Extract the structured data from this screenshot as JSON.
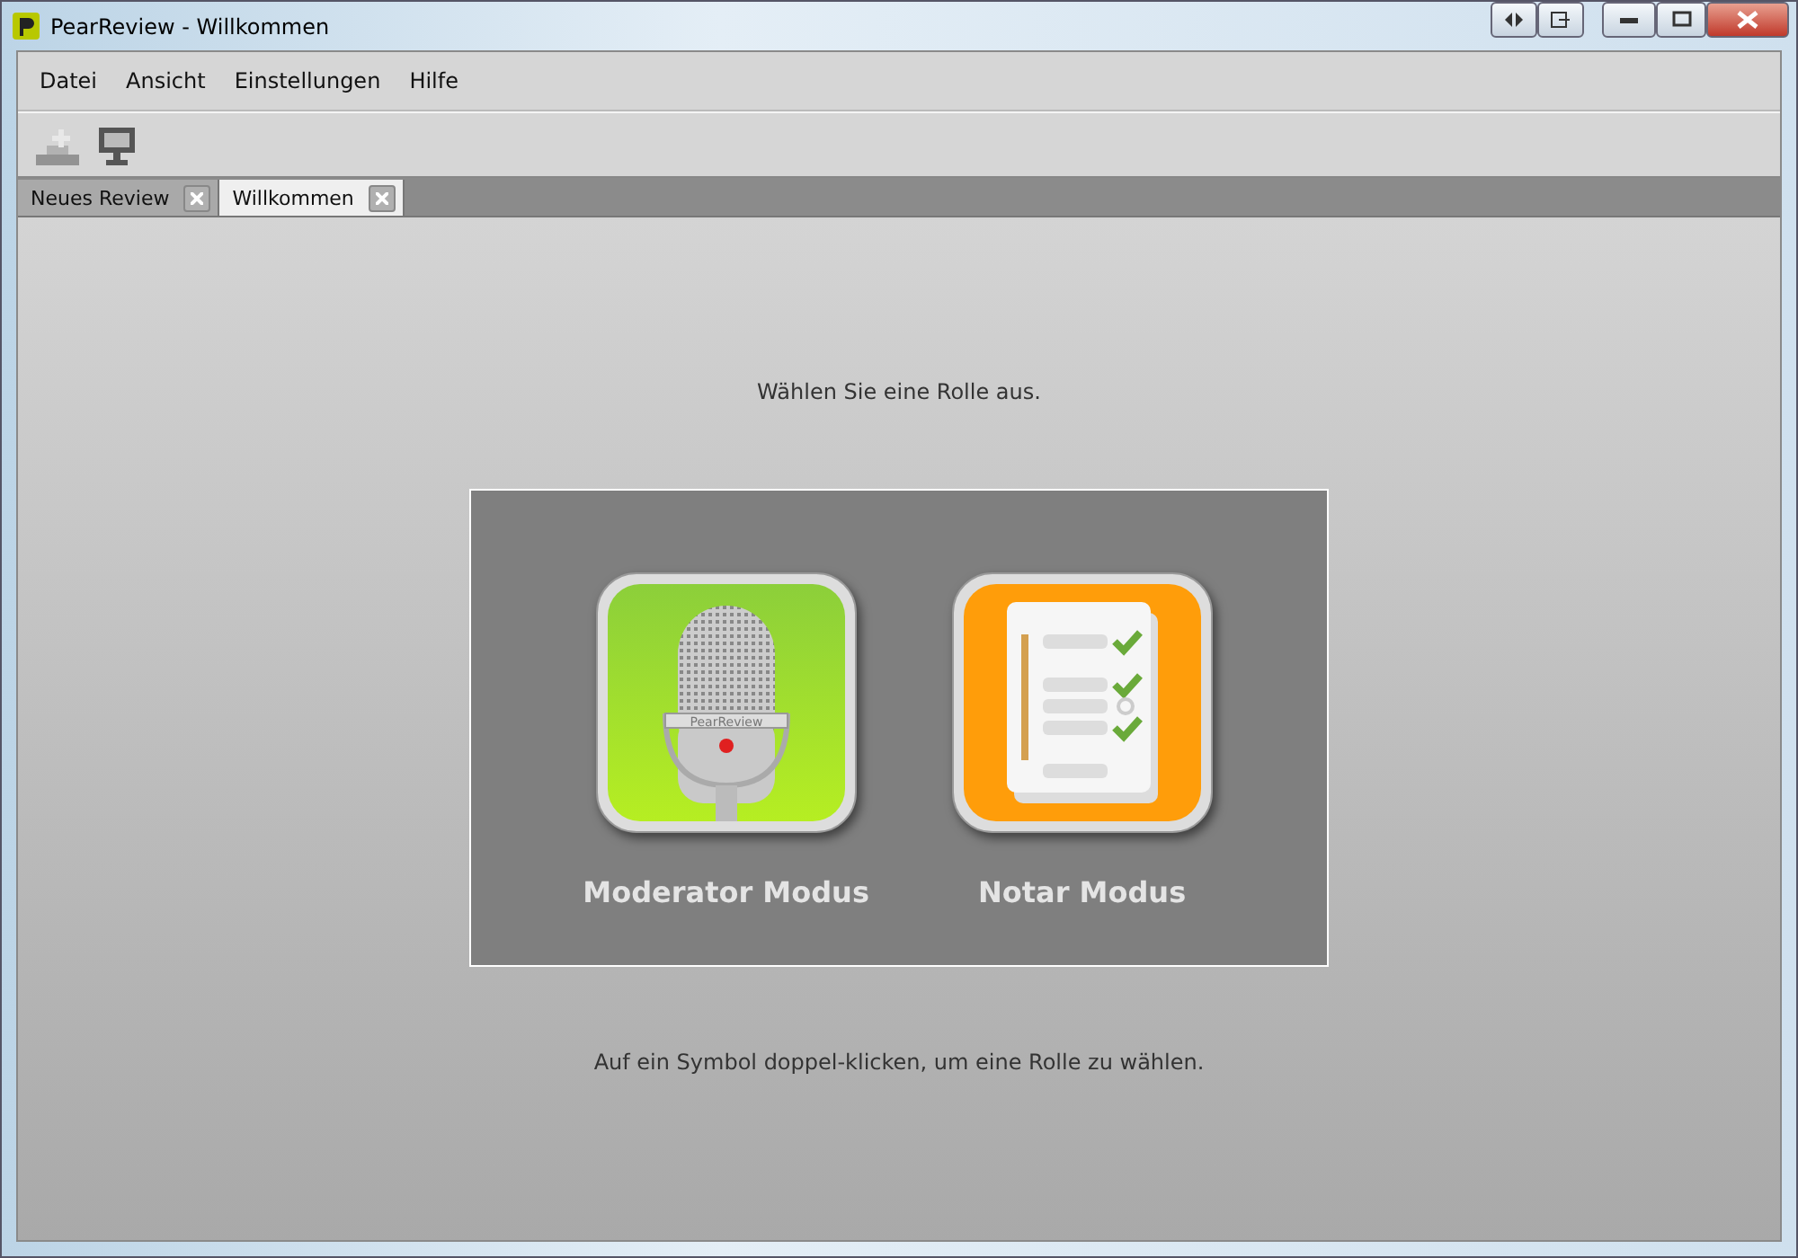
{
  "window": {
    "title": "PearReview - Willkommen"
  },
  "menu": [
    "Datei",
    "Ansicht",
    "Einstellungen",
    "Hilfe"
  ],
  "toolbar": [
    {
      "kind": "add",
      "disabled": true
    },
    {
      "kind": "screen",
      "disabled": false
    }
  ],
  "tabs": [
    {
      "label": "Neues Review",
      "selected": false
    },
    {
      "label": "Willkommen",
      "selected": true
    }
  ],
  "welcome": {
    "prompt": "Wählen Sie eine Rolle aus.",
    "roles": [
      {
        "kind": "moderator",
        "label": "Moderator Modus",
        "icon_text": "PearReview"
      },
      {
        "kind": "notary",
        "label": "Notar Modus"
      }
    ],
    "hint": "Auf ein Symbol doppel-klicken, um eine Rolle zu wählen."
  }
}
